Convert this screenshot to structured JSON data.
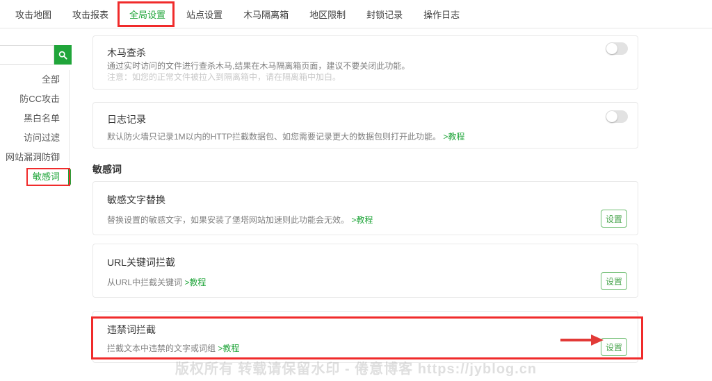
{
  "nav": {
    "tabs": [
      {
        "label": "攻击地图",
        "active": false
      },
      {
        "label": "攻击报表",
        "active": false
      },
      {
        "label": "全局设置",
        "active": true,
        "annotated": true
      },
      {
        "label": "站点设置",
        "active": false
      },
      {
        "label": "木马隔离箱",
        "active": false
      },
      {
        "label": "地区限制",
        "active": false
      },
      {
        "label": "封锁记录",
        "active": false
      },
      {
        "label": "操作日志",
        "active": false
      }
    ]
  },
  "sidebar": {
    "search": {
      "value": ""
    },
    "items": [
      {
        "label": "全部",
        "active": false
      },
      {
        "label": "防CC攻击",
        "active": false
      },
      {
        "label": "黑白名单",
        "active": false
      },
      {
        "label": "访问过滤",
        "active": false
      },
      {
        "label": "网站漏洞防御",
        "active": false
      },
      {
        "label": "敏感词",
        "active": true,
        "annotated": true
      }
    ]
  },
  "main": {
    "section_title": "敏感词",
    "cards": [
      {
        "title": "木马查杀",
        "desc": "通过实时访问的文件进行查杀木马,结果在木马隔离箱页面，建议不要关闭此功能。",
        "note": "注意：如您的正常文件被拉入到隔离箱中，请在隔离箱中加白。",
        "toggle_state": "off"
      },
      {
        "title": "日志记录",
        "desc": "默认防火墙只记录1M以内的HTTP拦截数据包、如您需要记录更大的数据包则打开此功能。",
        "link": ">教程",
        "toggle_state": "off"
      },
      {
        "title": "敏感文字替换",
        "desc": "替换设置的敏感文字，如果安装了堡塔网站加速则此功能会无效。",
        "link": ">教程",
        "button": "设置"
      },
      {
        "title": "URL关键词拦截",
        "desc": "从URL中拦截关键词",
        "link": ">教程",
        "button": "设置"
      },
      {
        "title": "违禁词拦截",
        "desc": "拦截文本中违禁的文字或词组",
        "link": ">教程",
        "button": "设置",
        "annotated": true
      }
    ]
  },
  "watermark": {
    "text": "版权所有 转载请保留水印 - 倦意博客 https://jyblog.cn"
  },
  "colors": {
    "accent": "#20a53a",
    "annotation": "#f02b2b"
  }
}
